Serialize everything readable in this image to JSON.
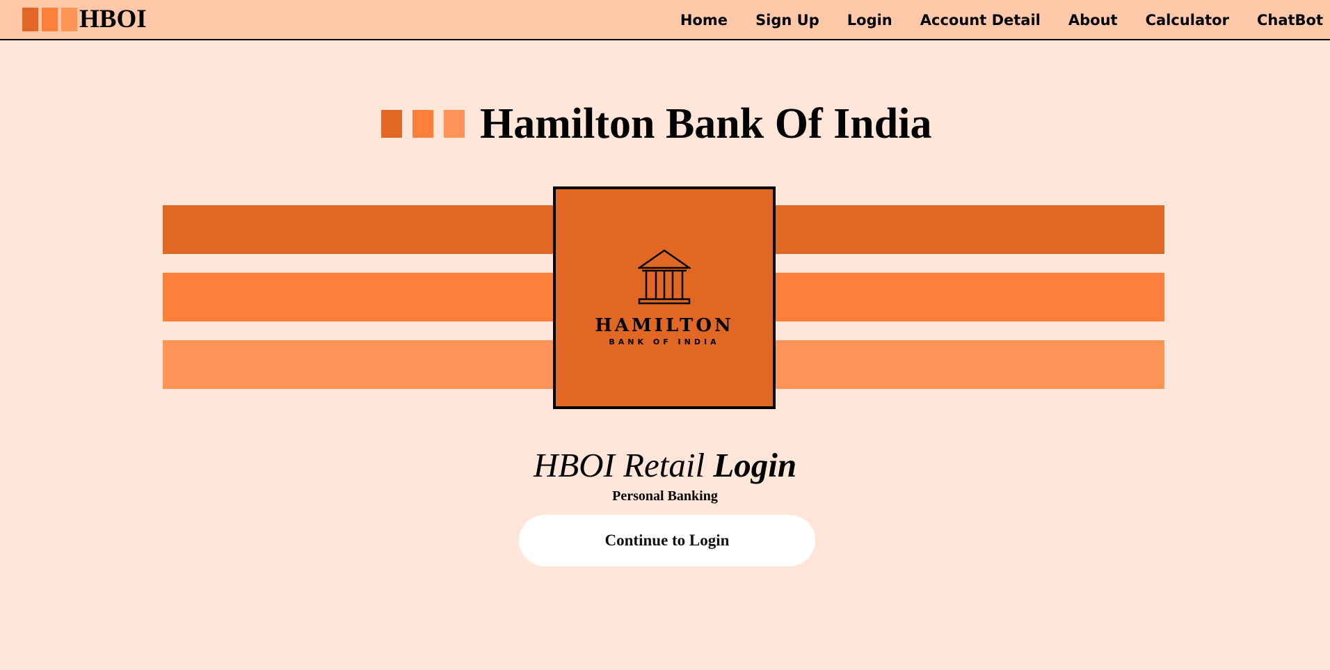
{
  "colors": {
    "page_background": "#ffe6d9",
    "navbar_background": "#ffc9a9",
    "orange_dark": "#e06824",
    "orange_mid": "#fd7f3c",
    "orange_light": "#ff9459",
    "button_background": "#ffffff"
  },
  "navbar": {
    "brand": "HBOI",
    "links": [
      {
        "label": "Home"
      },
      {
        "label": "Sign Up"
      },
      {
        "label": "Login"
      },
      {
        "label": "Account Detail"
      },
      {
        "label": "About"
      },
      {
        "label": "Calculator"
      },
      {
        "label": "ChatBot"
      }
    ]
  },
  "main": {
    "title": "Hamilton Bank Of India",
    "logo": {
      "icon": "bank-building-icon",
      "name": "HAMILTON",
      "subtitle": "BANK OF INDIA"
    },
    "login": {
      "heading_prefix": "HBOI Retail",
      "heading_emphasis": "Login",
      "subheading": "Personal Banking",
      "button_label": "Continue to Login"
    }
  }
}
